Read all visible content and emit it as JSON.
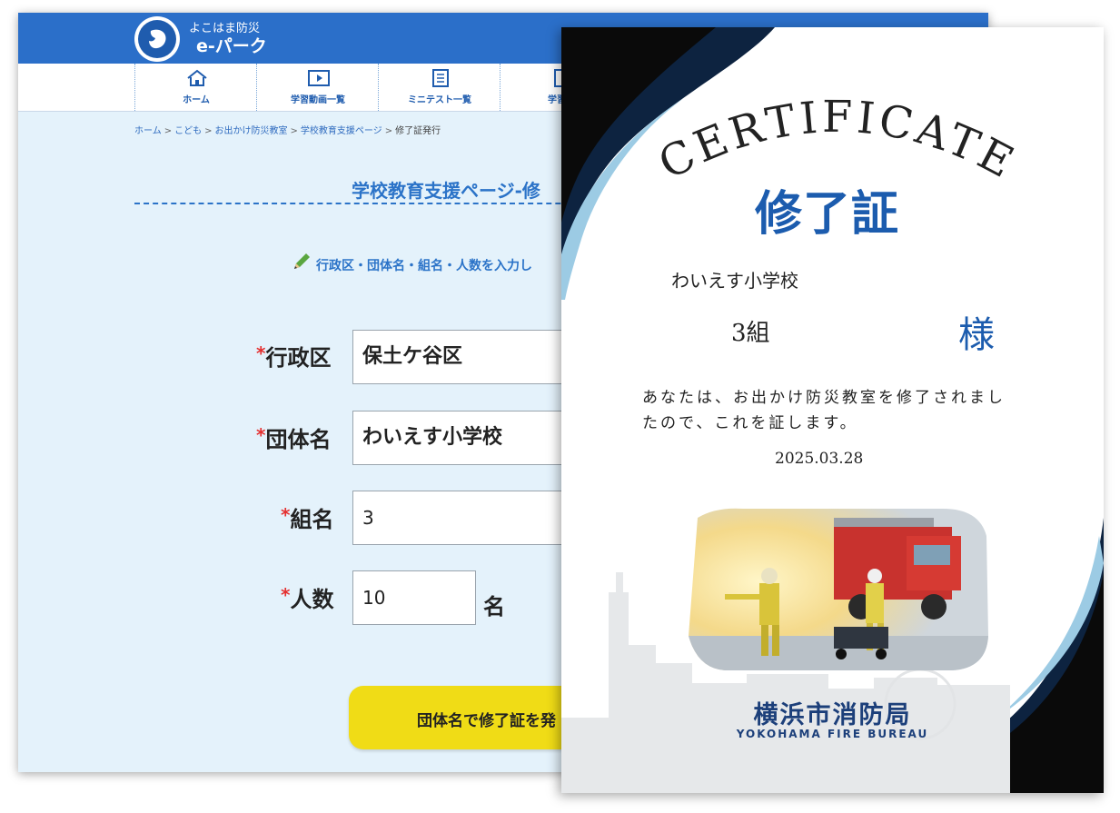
{
  "web": {
    "header": {
      "site_sub": "よこはま防災",
      "site_title": "e-パーク"
    },
    "nav": [
      {
        "label": "ホーム",
        "icon": "home-icon"
      },
      {
        "label": "学習動画一覧",
        "icon": "video-icon"
      },
      {
        "label": "ミニテスト一覧",
        "icon": "list-icon"
      },
      {
        "label": "学習資",
        "icon": "document-icon"
      }
    ],
    "breadcrumb": {
      "items": [
        "ホーム",
        "こども",
        "お出かけ防災教室",
        "学校教育支援ページ"
      ],
      "current": "修了証発行",
      "separator": ">"
    },
    "page_title": "学校教育支援ページ-修",
    "instruction": "行政区・団体名・組名・人数を入力し",
    "form": {
      "required_mark": "*",
      "ward": {
        "label": "行政区",
        "value": "保土ケ谷区"
      },
      "group": {
        "label": "団体名",
        "value": "わいえす小学校"
      },
      "class": {
        "label": "組名",
        "value": "3"
      },
      "people": {
        "label": "人数",
        "value": "10",
        "unit": "名"
      },
      "submit_label": "団体名で修了証を発"
    }
  },
  "certificate": {
    "title_en": "CERTIFICATE",
    "title_jp": "修了証",
    "organization": "わいえす小学校",
    "class_name": "3組",
    "honorific": "様",
    "message_line1": "あなたは、お出かけ防災教室を修了されまし",
    "message_line2": "たので、これを証します。",
    "date": "2025.03.28",
    "issuer": "横浜市消防局",
    "issuer_en": "YOKOHAMA FIRE BUREAU",
    "colors": {
      "navy": "#0d2340",
      "accent_blue": "#1c5cae",
      "light_blue": "#9ccbe4"
    }
  }
}
